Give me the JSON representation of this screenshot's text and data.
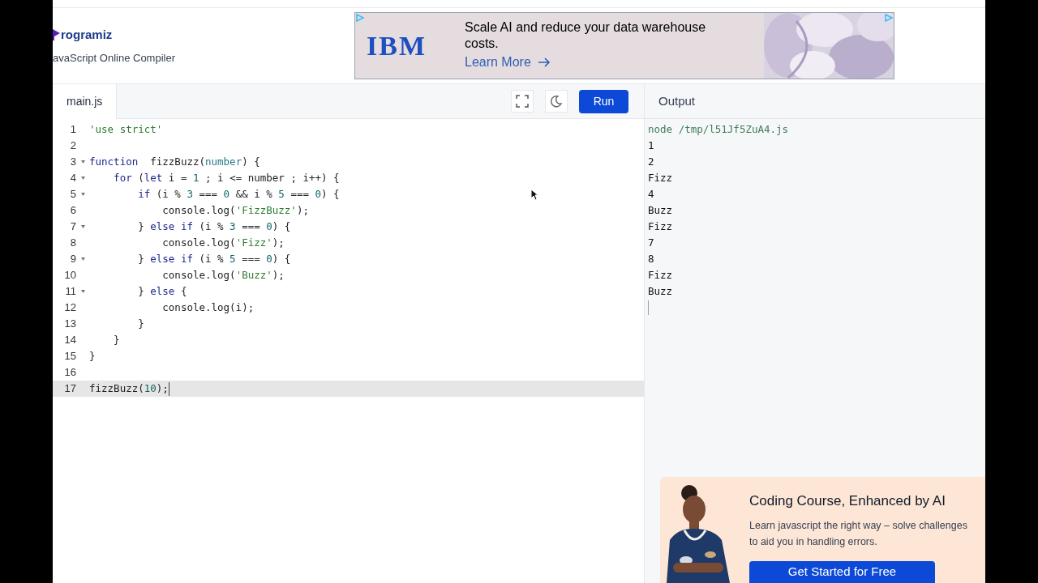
{
  "header": {
    "logo": "rogramiz",
    "subtitle": "avaScript Online Compiler"
  },
  "top_ad": {
    "brand": "IBM",
    "headline": "Scale AI and reduce your data warehouse costs.",
    "link": "Learn More"
  },
  "editor": {
    "tabs": [
      {
        "label": "main.js",
        "selected": true
      }
    ],
    "run_button": "Run",
    "lines": [
      {
        "number": "1",
        "fold": false,
        "active": false,
        "tokens": [
          {
            "kind": "string",
            "text": "'use strict'"
          }
        ]
      },
      {
        "number": "2",
        "fold": false,
        "active": false
      },
      {
        "number": "3",
        "fold": true,
        "active": false,
        "tokens": [
          {
            "kind": "keyword",
            "text": "function"
          },
          {
            "kind": "plain",
            "text": "  fizzBuzz("
          },
          {
            "kind": "param",
            "text": "number"
          },
          {
            "kind": "plain",
            "text": ") {"
          }
        ]
      },
      {
        "number": "4",
        "fold": true,
        "active": false,
        "tokens": [
          {
            "kind": "keyword",
            "text": "    for"
          },
          {
            "kind": "plain",
            "text": " ("
          },
          {
            "kind": "keyword",
            "text": "let"
          },
          {
            "kind": "plain",
            "text": " i = "
          },
          {
            "kind": "number",
            "text": "1"
          },
          {
            "kind": "plain",
            "text": " ; i <= number ; i++) {"
          }
        ]
      },
      {
        "number": "5",
        "fold": true,
        "active": false,
        "tokens": [
          {
            "kind": "keyword",
            "text": "        if"
          },
          {
            "kind": "plain",
            "text": " (i % "
          },
          {
            "kind": "number",
            "text": "3"
          },
          {
            "kind": "plain",
            "text": " === "
          },
          {
            "kind": "number",
            "text": "0"
          },
          {
            "kind": "plain",
            "text": " && i % "
          },
          {
            "kind": "number",
            "text": "5"
          },
          {
            "kind": "plain",
            "text": " === "
          },
          {
            "kind": "number",
            "text": "0"
          },
          {
            "kind": "plain",
            "text": ") {"
          }
        ]
      },
      {
        "number": "6",
        "fold": false,
        "active": false,
        "tokens": [
          {
            "kind": "plain",
            "text": "            console.log("
          },
          {
            "kind": "string",
            "text": "'FizzBuzz'"
          },
          {
            "kind": "plain",
            "text": ");"
          }
        ]
      },
      {
        "number": "7",
        "fold": true,
        "active": false,
        "tokens": [
          {
            "kind": "plain",
            "text": "        } "
          },
          {
            "kind": "keyword",
            "text": "else if"
          },
          {
            "kind": "plain",
            "text": " (i % "
          },
          {
            "kind": "number",
            "text": "3"
          },
          {
            "kind": "plain",
            "text": " === "
          },
          {
            "kind": "number",
            "text": "0"
          },
          {
            "kind": "plain",
            "text": ") {"
          }
        ]
      },
      {
        "number": "8",
        "fold": false,
        "active": false,
        "tokens": [
          {
            "kind": "plain",
            "text": "            console.log("
          },
          {
            "kind": "string",
            "text": "'Fizz'"
          },
          {
            "kind": "plain",
            "text": ");"
          }
        ]
      },
      {
        "number": "9",
        "fold": true,
        "active": false,
        "tokens": [
          {
            "kind": "plain",
            "text": "        } "
          },
          {
            "kind": "keyword",
            "text": "else if"
          },
          {
            "kind": "plain",
            "text": " (i % "
          },
          {
            "kind": "number",
            "text": "5"
          },
          {
            "kind": "plain",
            "text": " === "
          },
          {
            "kind": "number",
            "text": "0"
          },
          {
            "kind": "plain",
            "text": ") {"
          }
        ]
      },
      {
        "number": "10",
        "fold": false,
        "active": false,
        "tokens": [
          {
            "kind": "plain",
            "text": "            console.log("
          },
          {
            "kind": "string",
            "text": "'Buzz'"
          },
          {
            "kind": "plain",
            "text": ");"
          }
        ]
      },
      {
        "number": "11",
        "fold": true,
        "active": false,
        "tokens": [
          {
            "kind": "plain",
            "text": "        } "
          },
          {
            "kind": "keyword",
            "text": "else"
          },
          {
            "kind": "plain",
            "text": " {"
          }
        ]
      },
      {
        "number": "12",
        "fold": false,
        "active": false,
        "tokens": [
          {
            "kind": "plain",
            "text": "            console.log(i);"
          }
        ]
      },
      {
        "number": "13",
        "fold": false,
        "active": false,
        "tokens": [
          {
            "kind": "plain",
            "text": "        }"
          }
        ]
      },
      {
        "number": "14",
        "fold": false,
        "active": false,
        "tokens": [
          {
            "kind": "plain",
            "text": "    }"
          }
        ]
      },
      {
        "number": "15",
        "fold": false,
        "active": false,
        "tokens": [
          {
            "kind": "plain",
            "text": "}"
          }
        ]
      },
      {
        "number": "16",
        "fold": false,
        "active": false
      },
      {
        "number": "17",
        "fold": false,
        "active": true,
        "tokens": [
          {
            "kind": "plain",
            "text": "fizzBuzz("
          },
          {
            "kind": "number",
            "text": "10"
          },
          {
            "kind": "plain",
            "text": ");"
          }
        ]
      }
    ]
  },
  "output": {
    "title": "Output",
    "command": "node /tmp/l51Jf5ZuA4.js",
    "lines": [
      "1",
      "2",
      "Fizz",
      "4",
      "Buzz",
      "Fizz",
      "7",
      "8",
      "Fizz",
      "Buzz"
    ]
  },
  "bottom_ad": {
    "title": "Coding Course, Enhanced by AI",
    "text": "Learn javascript the right way – solve challenges",
    "text_2": "to aid you in handling errors.",
    "button": "Get Started for Free"
  }
}
